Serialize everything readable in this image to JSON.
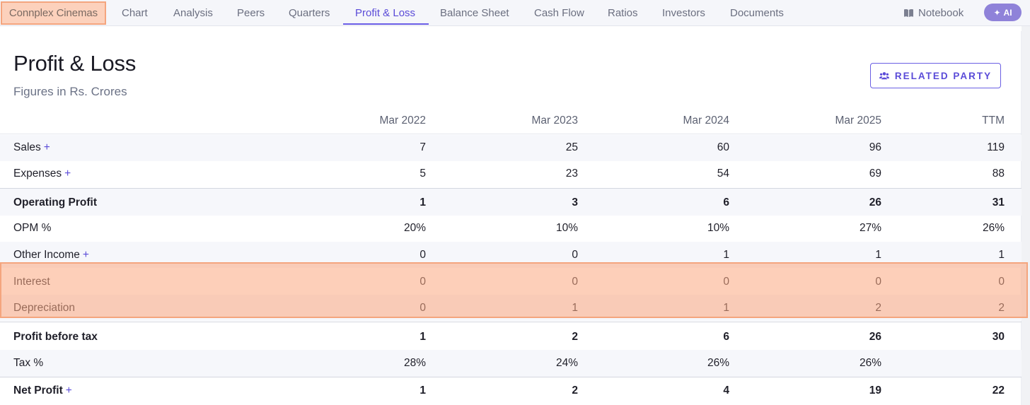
{
  "app": {
    "company_name": "Connplex Cinemas",
    "notebook_label": "Notebook",
    "ai_label": "AI"
  },
  "nav": {
    "tabs": [
      {
        "label": "Chart"
      },
      {
        "label": "Analysis"
      },
      {
        "label": "Peers"
      },
      {
        "label": "Quarters"
      },
      {
        "label": "Profit & Loss",
        "active": true
      },
      {
        "label": "Balance Sheet"
      },
      {
        "label": "Cash Flow"
      },
      {
        "label": "Ratios"
      },
      {
        "label": "Investors"
      },
      {
        "label": "Documents"
      }
    ]
  },
  "main": {
    "title": "Profit & Loss",
    "subtitle": "Figures in Rs. Crores",
    "related_party_label": "RELATED PARTY"
  },
  "table": {
    "columns": [
      "Mar 2022",
      "Mar 2023",
      "Mar 2024",
      "Mar 2025",
      "TTM"
    ],
    "rows": [
      {
        "label": "Sales",
        "plus": "+",
        "values": [
          "7",
          "25",
          "60",
          "96",
          "119"
        ]
      },
      {
        "label": "Expenses",
        "plus": "+",
        "values": [
          "5",
          "23",
          "54",
          "69",
          "88"
        ]
      },
      {
        "label": "Operating Profit",
        "values": [
          "1",
          "3",
          "6",
          "26",
          "31"
        ]
      },
      {
        "label": "OPM %",
        "values": [
          "20%",
          "10%",
          "10%",
          "27%",
          "26%"
        ]
      },
      {
        "label": "Other Income",
        "plus": "+",
        "values": [
          "0",
          "0",
          "1",
          "1",
          "1"
        ]
      },
      {
        "label": "Interest",
        "values": [
          "0",
          "0",
          "0",
          "0",
          "0"
        ]
      },
      {
        "label": "Depreciation",
        "values": [
          "0",
          "1",
          "1",
          "2",
          "2"
        ]
      },
      {
        "label": "Profit before tax",
        "values": [
          "1",
          "2",
          "6",
          "26",
          "30"
        ]
      },
      {
        "label": "Tax %",
        "values": [
          "28%",
          "24%",
          "26%",
          "26%",
          ""
        ]
      },
      {
        "label": "Net Profit",
        "plus": "+",
        "values": [
          "1",
          "2",
          "4",
          "19",
          "22"
        ]
      }
    ]
  },
  "colors": {
    "accent": "#5a4bd8",
    "highlight": "#fcd1bc",
    "highlight_border": "#f4a57e",
    "ai_button": "#8f82d9"
  },
  "icons": {
    "notebook": "book-icon",
    "ai": "sparkle-icon",
    "related_party": "users-icon",
    "expand": "plus-icon"
  }
}
